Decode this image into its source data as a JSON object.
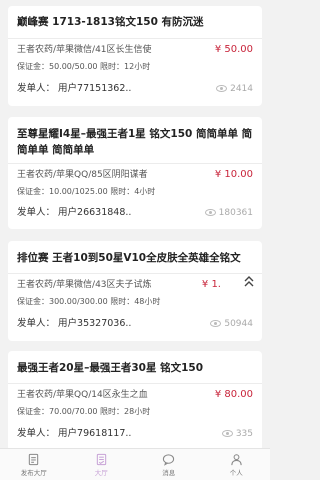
{
  "listings": [
    {
      "title": "巅峰赛 1713-1813铭文150 有防沉迷",
      "account": "王者农药/苹果微信/41区长生信使",
      "price": "¥ 50.00",
      "terms": "保证金：50.00/50.00 限时：12小时",
      "publisher": "发单人：  用户77151362..",
      "views": "2414"
    },
    {
      "title": "至尊星耀I4星–最强王者1星 铭文150 简简单单 简简单单 简简单单",
      "account": "王者农药/苹果QQ/85区阴阳谋者",
      "price": "¥ 10.00",
      "terms": "保证金：10.00/1025.00 限时：4小时",
      "publisher": "发单人：  用户26631848..",
      "views": "180361"
    },
    {
      "title": "排位赛 王者10到50星V10全皮肤全英雄全铭文",
      "account": "王者农药/苹果微信/43区夫子试炼",
      "price": "¥ 1.",
      "terms": "保证金：300.00/300.00 限时：48小时",
      "publisher": "发单人：  用户35327036..",
      "views": "50944"
    },
    {
      "title": "最强王者20星–最强王者30星 铭文150",
      "account": "王者农药/苹果QQ/14区永生之血",
      "price": "¥ 80.00",
      "terms": "保证金：70.00/70.00 限时：28小时",
      "publisher": "发单人：  用户79618117..",
      "views": "335"
    }
  ],
  "collapse_icon": "double-chevron-up-icon",
  "tabs": [
    {
      "label": "发布大厅",
      "icon": "document-icon"
    },
    {
      "label": "大厅",
      "icon": "list-icon"
    },
    {
      "label": "消息",
      "icon": "chat-bubble-icon"
    },
    {
      "label": "个人",
      "icon": "person-icon"
    }
  ],
  "colors": {
    "price": "#c8243a",
    "active_tab": "#c7a2d6",
    "background": "#f2f2f2"
  }
}
